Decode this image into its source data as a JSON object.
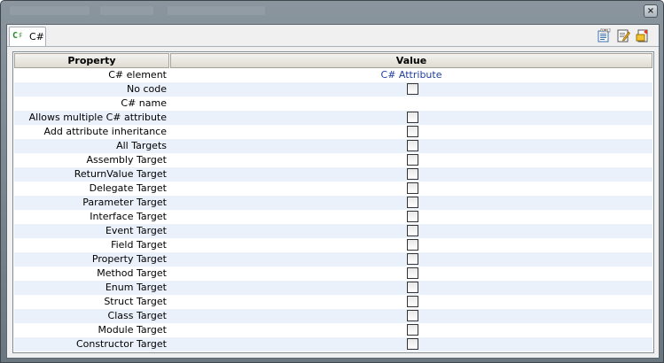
{
  "tab": {
    "icon": "csharp-icon",
    "label": "C#"
  },
  "toolbar": {
    "icons": [
      "uml-document-icon",
      "edit-document-icon",
      "export-document-icon"
    ]
  },
  "grid": {
    "header": {
      "property": "Property",
      "value": "Value"
    },
    "rows": [
      {
        "property": "C# element",
        "value": "C# Attribute",
        "kind": "text"
      },
      {
        "property": "No code",
        "kind": "checkbox",
        "checked": false
      },
      {
        "property": "C# name",
        "value": "",
        "kind": "text"
      },
      {
        "property": "Allows multiple C# attribute",
        "kind": "checkbox",
        "checked": false
      },
      {
        "property": "Add attribute inheritance",
        "kind": "checkbox",
        "checked": false
      },
      {
        "property": "All Targets",
        "kind": "checkbox",
        "checked": false
      },
      {
        "property": "Assembly Target",
        "kind": "checkbox",
        "checked": false
      },
      {
        "property": "ReturnValue Target",
        "kind": "checkbox",
        "checked": false
      },
      {
        "property": "Delegate Target",
        "kind": "checkbox",
        "checked": false
      },
      {
        "property": "Parameter Target",
        "kind": "checkbox",
        "checked": false
      },
      {
        "property": "Interface Target",
        "kind": "checkbox",
        "checked": false
      },
      {
        "property": "Event Target",
        "kind": "checkbox",
        "checked": false
      },
      {
        "property": "Field Target",
        "kind": "checkbox",
        "checked": false
      },
      {
        "property": "Property Target",
        "kind": "checkbox",
        "checked": false
      },
      {
        "property": "Method Target",
        "kind": "checkbox",
        "checked": false
      },
      {
        "property": "Enum Target",
        "kind": "checkbox",
        "checked": false
      },
      {
        "property": "Struct Target",
        "kind": "checkbox",
        "checked": false
      },
      {
        "property": "Class Target",
        "kind": "checkbox",
        "checked": false
      },
      {
        "property": "Module Target",
        "kind": "checkbox",
        "checked": false
      },
      {
        "property": "Constructor Target",
        "kind": "checkbox",
        "checked": false
      }
    ]
  },
  "window": {
    "close_glyph": "×"
  }
}
